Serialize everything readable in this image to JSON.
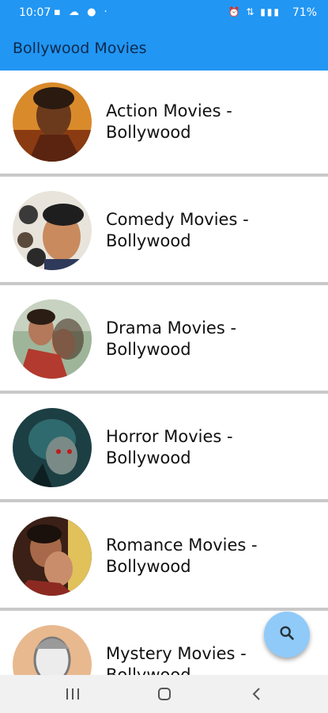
{
  "status_bar": {
    "time": "10:07",
    "battery": "71%"
  },
  "app_bar": {
    "title": "Bollywood Movies"
  },
  "categories": [
    {
      "label": "Action Movies - Bollywood",
      "image": "action-movie-poster"
    },
    {
      "label": "Comedy Movies - Bollywood",
      "image": "comedy-movie-poster"
    },
    {
      "label": "Drama Movies - Bollywood",
      "image": "drama-movie-poster"
    },
    {
      "label": "Horror Movies - Bollywood",
      "image": "horror-movie-poster"
    },
    {
      "label": "Romance Movies - Bollywood",
      "image": "romance-movie-poster"
    },
    {
      "label": "Mystery Movies - Bollywood",
      "image": "mystery-movie-poster"
    }
  ],
  "fab": {
    "icon": "search-icon"
  },
  "nav_bar": {
    "icons": [
      "recent-apps-icon",
      "home-icon",
      "back-icon"
    ]
  },
  "colors": {
    "app_bar": "#2196F3",
    "fab": "#90CAF9",
    "divider": "#c9c9c9"
  }
}
